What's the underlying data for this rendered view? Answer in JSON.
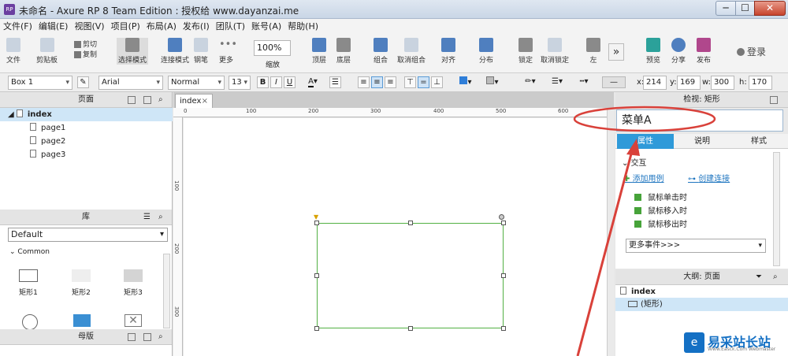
{
  "window": {
    "title": "未命名 - Axure RP 8 Team Edition : 授权给 www.dayanzai.me",
    "app_icon": "RP",
    "min": "─",
    "max": "☐",
    "close": "✕"
  },
  "menu": [
    "文件(F)",
    "编辑(E)",
    "视图(V)",
    "项目(P)",
    "布局(A)",
    "发布(I)",
    "团队(T)",
    "账号(A)",
    "帮助(H)"
  ],
  "toolbar": {
    "file": "文件",
    "paste": "剪贴板",
    "cut_label": "剪切",
    "copy_label": "复制",
    "select": "选择模式",
    "connect": "连接模式",
    "pen": "钢笔",
    "more": "更多",
    "zoom_value": "100%",
    "zoom": "缩放",
    "top": "顶层",
    "bottom": "底层",
    "group": "组合",
    "ungroup": "取消组合",
    "align": "对齐",
    "distribute": "分布",
    "lock": "锁定",
    "unlock": "取消锁定",
    "left": "左",
    "preview": "预览",
    "share": "分享",
    "publish": "发布",
    "login": "登录"
  },
  "format": {
    "widget_name": "Box 1",
    "font": "Arial",
    "style": "Normal",
    "size": "13",
    "x_label": "x:",
    "x": "214",
    "y_label": "y:",
    "y": "169",
    "w_label": "w:",
    "w": "300",
    "h_label": "h:",
    "h": "170"
  },
  "pages": {
    "title": "页面",
    "root": "index",
    "children": [
      "page1",
      "page2",
      "page3"
    ]
  },
  "libraries": {
    "title": "库",
    "selected": "Default",
    "group": "Common",
    "widgets": [
      "矩形1",
      "矩形2",
      "矩形3"
    ]
  },
  "masters": {
    "title": "母版"
  },
  "canvas": {
    "tab": "index",
    "ruler_h": [
      "0",
      "100",
      "200",
      "300",
      "400",
      "500",
      "600"
    ],
    "ruler_v": [
      "100",
      "200",
      "300"
    ]
  },
  "inspector": {
    "title": "检视: 矩形",
    "name_value": "菜单A",
    "tabs": [
      "属性",
      "说明",
      "样式"
    ],
    "section": "交互",
    "add_case": "添加用例",
    "create_link": "创建连接",
    "events": [
      "鼠标单击时",
      "鼠标移入时",
      "鼠标移出时"
    ],
    "more_events": "更多事件>>>"
  },
  "outline": {
    "title": "大纲: 页面",
    "root": "index",
    "item": "(矩形)"
  },
  "watermark": {
    "text": "易采站长站",
    "sub": "Www.Easck.Com Webmaster",
    "logo": "e"
  },
  "colors": {
    "accent": "#2f9ad9",
    "selection": "#52b043",
    "annotation": "#d9413a"
  }
}
